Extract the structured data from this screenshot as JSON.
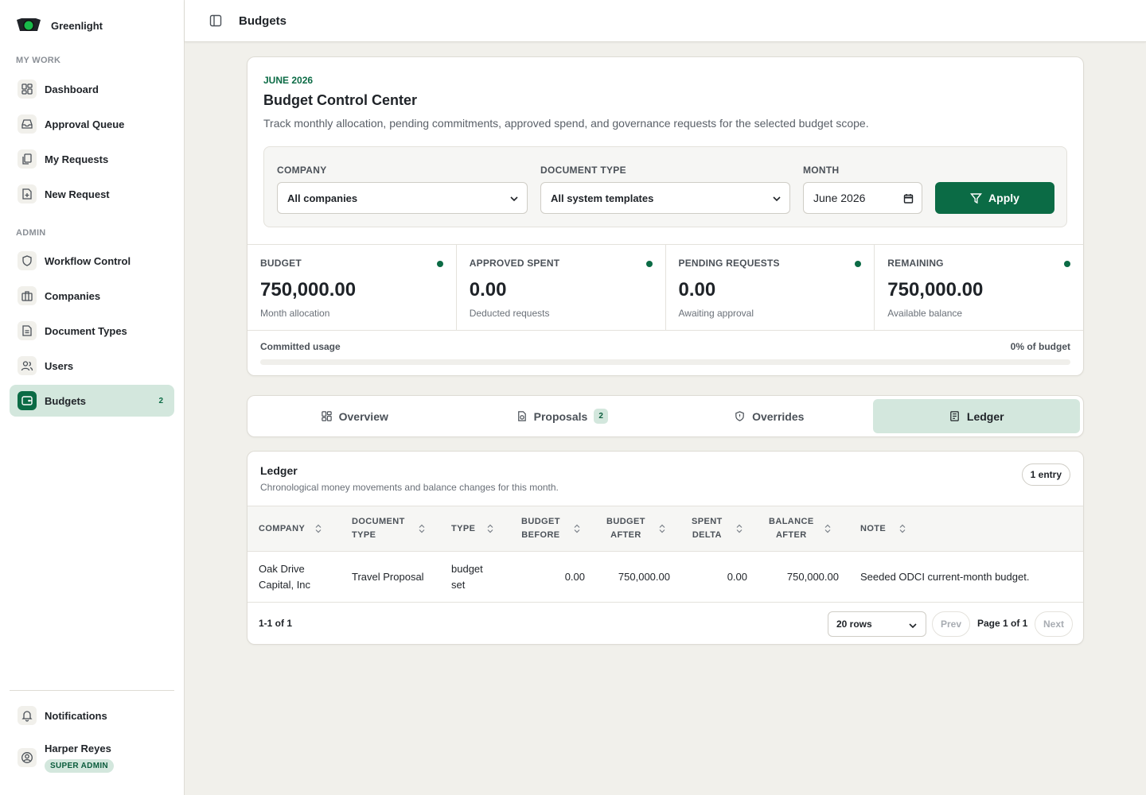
{
  "app": {
    "name": "Greenlight"
  },
  "sidebar": {
    "sections": [
      {
        "label": "MY WORK"
      },
      {
        "label": "ADMIN"
      }
    ],
    "items": [
      {
        "label": "Dashboard",
        "icon": "dashboard-icon"
      },
      {
        "label": "Approval Queue",
        "icon": "inbox-icon"
      },
      {
        "label": "My Requests",
        "icon": "copy-icon"
      },
      {
        "label": "New Request",
        "icon": "file-plus-icon"
      },
      {
        "label": "Workflow Control",
        "icon": "shield-icon"
      },
      {
        "label": "Companies",
        "icon": "briefcase-icon"
      },
      {
        "label": "Document Types",
        "icon": "file-text-icon"
      },
      {
        "label": "Users",
        "icon": "users-icon"
      },
      {
        "label": "Budgets",
        "icon": "wallet-icon",
        "badge": "2",
        "active": true
      }
    ],
    "notifications": "Notifications",
    "user": {
      "name": "Harper Reyes",
      "role": "SUPER ADMIN"
    }
  },
  "topbar": {
    "title": "Budgets"
  },
  "hero": {
    "eyebrow": "JUNE 2026",
    "title": "Budget Control Center",
    "description": "Track monthly allocation, pending commitments, approved spend, and governance requests for the selected budget scope.",
    "filters": {
      "company_label": "COMPANY",
      "company_value": "All companies",
      "doctype_label": "DOCUMENT TYPE",
      "doctype_value": "All system templates",
      "month_label": "MONTH",
      "month_value": "June 2026",
      "apply_label": "Apply"
    },
    "stats": [
      {
        "label": "BUDGET",
        "value": "750,000.00",
        "sub": "Month allocation"
      },
      {
        "label": "APPROVED SPENT",
        "value": "0.00",
        "sub": "Deducted requests"
      },
      {
        "label": "PENDING REQUESTS",
        "value": "0.00",
        "sub": "Awaiting approval"
      },
      {
        "label": "REMAINING",
        "value": "750,000.00",
        "sub": "Available balance"
      }
    ],
    "usage": {
      "label": "Committed usage",
      "percent_text": "0% of budget",
      "fraction": 0
    }
  },
  "tabs": [
    {
      "label": "Overview",
      "icon": "grid-icon"
    },
    {
      "label": "Proposals",
      "icon": "proposal-icon",
      "badge": "2"
    },
    {
      "label": "Overrides",
      "icon": "shield-alert-icon"
    },
    {
      "label": "Ledger",
      "icon": "ledger-icon",
      "active": true
    }
  ],
  "ledger": {
    "title": "Ledger",
    "description": "Chronological money movements and balance changes for this month.",
    "entry_count": "1 entry",
    "columns": [
      {
        "line1": "COMPANY",
        "line2": ""
      },
      {
        "line1": "DOCUMENT",
        "line2": "TYPE"
      },
      {
        "line1": "TYPE",
        "line2": ""
      },
      {
        "line1": "BUDGET",
        "line2": "BEFORE"
      },
      {
        "line1": "BUDGET",
        "line2": "AFTER"
      },
      {
        "line1": "SPENT",
        "line2": "DELTA"
      },
      {
        "line1": "BALANCE",
        "line2": "AFTER"
      },
      {
        "line1": "NOTE",
        "line2": ""
      }
    ],
    "rows": [
      {
        "company_l1": "Oak Drive",
        "company_l2": "Capital, Inc",
        "document_type": "Travel Proposal",
        "type_l1": "budget",
        "type_l2": "set",
        "budget_before": "0.00",
        "budget_after": "750,000.00",
        "spent_delta": "0.00",
        "balance_after": "750,000.00",
        "note": "Seeded ODCI current-month budget."
      }
    ],
    "footer": {
      "count": "1-1 of 1",
      "rows_per_page": "20 rows",
      "prev": "Prev",
      "page_info": "Page 1 of 1",
      "next": "Next"
    }
  },
  "colors": {
    "accent": "#0b6b45",
    "accent_soft": "#d3e7dd",
    "background": "#f1f0eb"
  }
}
